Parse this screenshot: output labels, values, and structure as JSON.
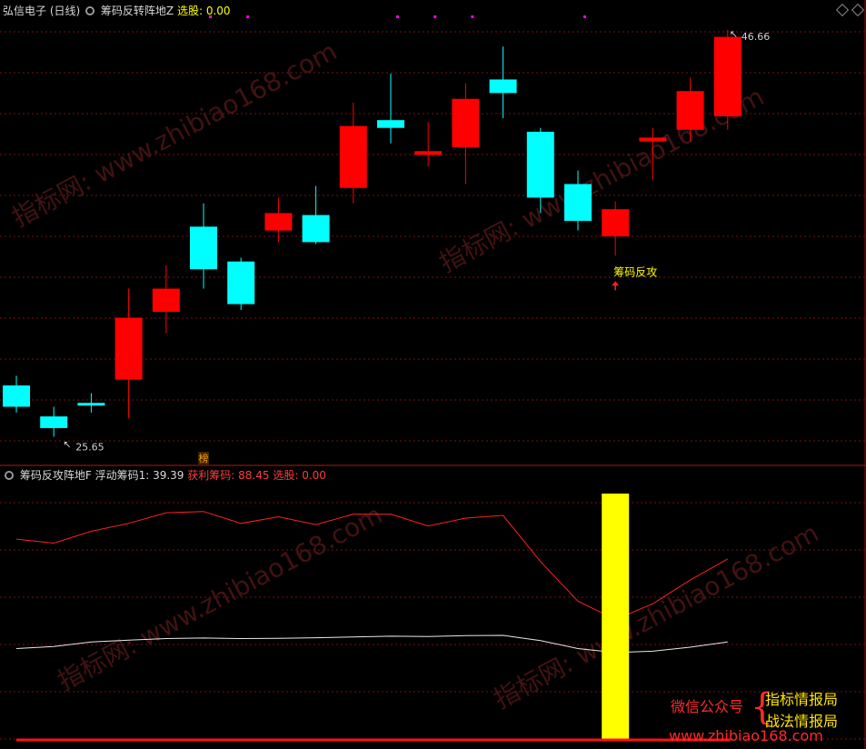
{
  "header": {
    "stock_name": "弘信电子",
    "period": "(日线)",
    "indicator_name": "筹码反转阵地Z",
    "pick_label": "选股:",
    "pick_value": "0.00"
  },
  "sub_header": {
    "indicator_name": "筹码反攻阵地F",
    "float_label": "浮动筹码1:",
    "float_value": "39.39",
    "profit_label": "获利筹码:",
    "profit_value": "88.45",
    "pick_label": "选股:",
    "pick_value": "0.00"
  },
  "markers": {
    "high_label": "46.66",
    "low_label": "25.65",
    "signal_label": "筹码反攻",
    "bang_label": "榜"
  },
  "watermark": {
    "diag_text": "指标网: www.zhibiao168.com",
    "gzh": "微信公众号",
    "line1": "指标情报局",
    "line2": "战法情报局",
    "url": "www.zhibiao168.com"
  },
  "colors": {
    "up": "#ff0000",
    "down": "#00ffff",
    "grid": "#7a1010",
    "profit_line": "#ff2020",
    "float_line": "#e8e8e8",
    "signal_bar": "#ffff00",
    "signal_text": "#ffff00",
    "pick_dot": "#ff00ff"
  },
  "chart_data": [
    {
      "type": "candlestick",
      "title": "筹码反转阵地Z",
      "ylim": [
        24.5,
        47.5
      ],
      "candles": [
        {
          "o": 28.3,
          "c": 27.2,
          "h": 28.8,
          "l": 26.9
        },
        {
          "o": 26.7,
          "c": 26.1,
          "h": 27.2,
          "l": 25.65
        },
        {
          "o": 27.4,
          "c": 27.3,
          "h": 27.9,
          "l": 26.9
        },
        {
          "o": 28.6,
          "c": 31.8,
          "h": 33.3,
          "l": 26.6
        },
        {
          "o": 32.1,
          "c": 33.3,
          "h": 34.5,
          "l": 31.0
        },
        {
          "o": 36.5,
          "c": 34.3,
          "h": 37.7,
          "l": 33.3
        },
        {
          "o": 34.7,
          "c": 32.5,
          "h": 34.9,
          "l": 32.2
        },
        {
          "o": 36.3,
          "c": 37.2,
          "h": 38.0,
          "l": 35.7
        },
        {
          "o": 37.1,
          "c": 35.7,
          "h": 38.6,
          "l": 35.6
        },
        {
          "o": 38.5,
          "c": 41.7,
          "h": 42.9,
          "l": 37.7
        },
        {
          "o": 42.0,
          "c": 41.6,
          "h": 44.4,
          "l": 40.8
        },
        {
          "o": 40.2,
          "c": 40.4,
          "h": 41.9,
          "l": 39.6
        },
        {
          "o": 40.6,
          "c": 43.1,
          "h": 43.9,
          "l": 38.7
        },
        {
          "o": 44.1,
          "c": 43.4,
          "h": 45.8,
          "l": 42.1
        },
        {
          "o": 41.4,
          "c": 38.0,
          "h": 41.6,
          "l": 37.2
        },
        {
          "o": 38.7,
          "c": 36.8,
          "h": 39.4,
          "l": 36.3
        },
        {
          "o": 36.0,
          "c": 37.4,
          "h": 37.8,
          "l": 35.0
        },
        {
          "o": 40.9,
          "c": 41.1,
          "h": 41.6,
          "l": 38.9
        },
        {
          "o": 41.5,
          "c": 43.5,
          "h": 44.2,
          "l": 40.9
        },
        {
          "o": 42.2,
          "c": 46.3,
          "h": 46.66,
          "l": 41.5
        }
      ],
      "annotations": [
        {
          "index": 1,
          "text": "25.65"
        },
        {
          "index": 19,
          "text": "46.66"
        },
        {
          "index": 16,
          "text": "筹码反攻",
          "arrow": "up"
        }
      ]
    },
    {
      "type": "line",
      "title": "筹码反攻阵地F",
      "ylim": [
        0,
        100
      ],
      "series": [
        {
          "name": "浮动筹码1",
          "values": [
            35.0,
            35.8,
            37.5,
            38.2,
            38.8,
            39.0,
            38.8,
            38.9,
            39.1,
            39.4,
            39.7,
            39.6,
            39.9,
            40.0,
            38.0,
            35.0,
            33.5,
            34.0,
            35.5,
            37.5
          ]
        },
        {
          "name": "获利筹码",
          "values": [
            76.5,
            75.0,
            79.5,
            82.5,
            86.5,
            87.0,
            82.5,
            85.0,
            82.0,
            86.0,
            86.0,
            81.5,
            84.5,
            85.5,
            68.0,
            53.0,
            46.0,
            52.0,
            61.0,
            69.0
          ]
        },
        {
          "name": "选股",
          "values": [
            0,
            0,
            0,
            0,
            0,
            0,
            0,
            0,
            0,
            0,
            0,
            0,
            0,
            0,
            0,
            0,
            100,
            0,
            0,
            0
          ]
        }
      ]
    }
  ]
}
